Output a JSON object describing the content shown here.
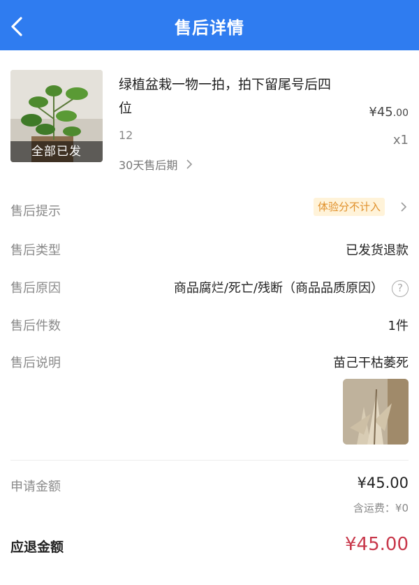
{
  "header": {
    "title": "售后详情"
  },
  "product": {
    "name": "绿植盆栽一物一拍，拍下留尾号后四位",
    "price_main": "¥45",
    "price_decimal": ".00",
    "spec": "12",
    "quantity": "x1",
    "ship_status": "全部已发",
    "after_sale_period": "30天售后期"
  },
  "details": {
    "tip_label": "售后提示",
    "tip_value": "体验分不计入",
    "type_label": "售后类型",
    "type_value": "已发货退款",
    "reason_label": "售后原因",
    "reason_value": "商品腐烂/死亡/残断（商品品质原因）",
    "count_label": "售后件数",
    "count_value": "1件",
    "desc_label": "售后说明",
    "desc_value": "苗己干枯萎死"
  },
  "amounts": {
    "apply_label": "申请金额",
    "apply_value": "¥45.00",
    "shipping_note": "含运费：¥0",
    "refund_label": "应退金额",
    "refund_value": "¥45.00"
  },
  "colors": {
    "header_bg": "#2f7cf0",
    "refund_red": "#c8374a",
    "badge_bg": "#fff3d9",
    "badge_text": "#e0902b"
  }
}
